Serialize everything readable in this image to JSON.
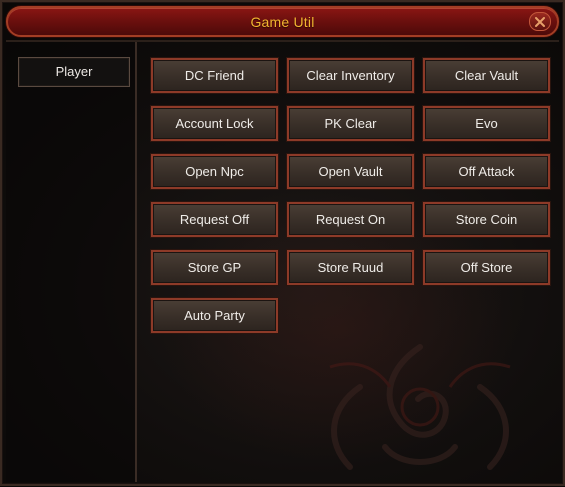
{
  "window": {
    "title": "Game Util",
    "close_icon": "close-x-icon",
    "colors": {
      "titlebar": "#6d100e",
      "title_text": "#f2b531",
      "button_border": "#8d3a28",
      "button_fill": "#3a3029",
      "background": "#110e0d"
    }
  },
  "sidebar": {
    "items": [
      {
        "label": "Player"
      }
    ]
  },
  "buttons": [
    {
      "label": "DC Friend"
    },
    {
      "label": "Clear Inventory"
    },
    {
      "label": "Clear Vault"
    },
    {
      "label": "Account Lock"
    },
    {
      "label": "PK Clear"
    },
    {
      "label": "Evo"
    },
    {
      "label": "Open Npc"
    },
    {
      "label": "Open Vault"
    },
    {
      "label": "Off Attack"
    },
    {
      "label": "Request Off"
    },
    {
      "label": "Request On"
    },
    {
      "label": "Store Coin"
    },
    {
      "label": "Store GP"
    },
    {
      "label": "Store Ruud"
    },
    {
      "label": "Off Store"
    },
    {
      "label": "Auto Party"
    }
  ]
}
